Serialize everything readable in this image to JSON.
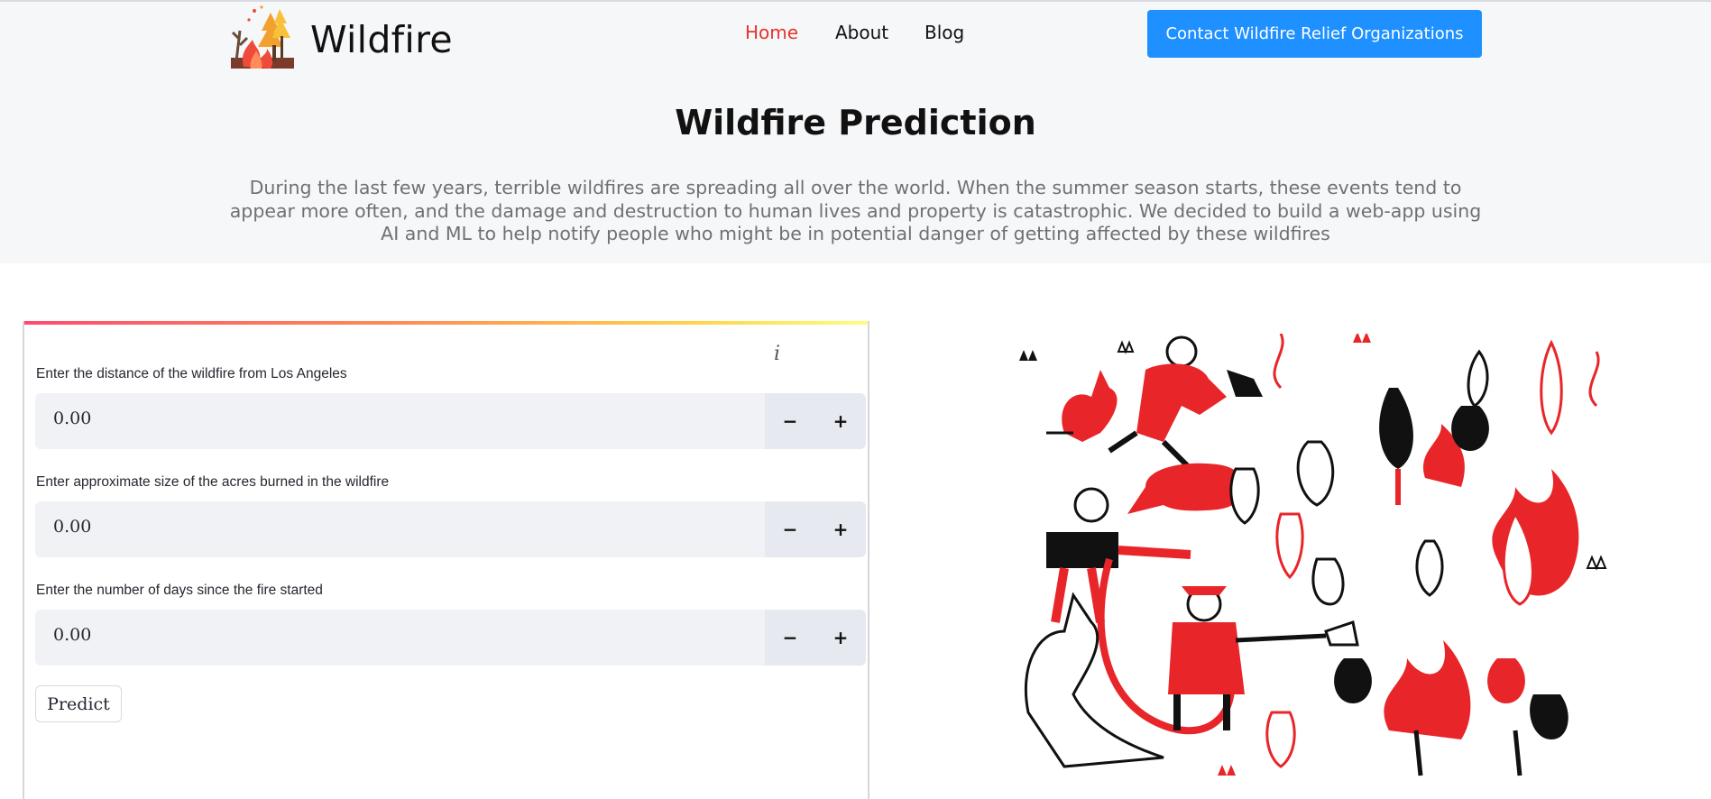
{
  "header": {
    "brand": "Wildfire",
    "nav": [
      {
        "label": "Home",
        "active": true
      },
      {
        "label": "About",
        "active": false
      },
      {
        "label": "Blog",
        "active": false
      }
    ],
    "cta_label": "Contact Wildfire Relief Organizations"
  },
  "hero": {
    "title": "Wildfire Prediction",
    "description": "During the last few years, terrible wildfires are spreading all over the world. When the summer season starts, these events tend to appear more often, and the damage and destruction to human lives and property is catastrophic. We decided to build a web-app using AI and ML to help notify people who might be in potential danger of getting affected by these wildfires"
  },
  "form": {
    "info_glyph": "i",
    "fields": [
      {
        "label": "Enter the distance of the wildfire from Los Angeles",
        "value": "0.00"
      },
      {
        "label": "Enter approximate size of the acres burned in the wildfire",
        "value": "0.00"
      },
      {
        "label": "Enter the number of days since the fire started",
        "value": "0.00"
      }
    ],
    "minus_glyph": "−",
    "plus_glyph": "+",
    "predict_label": "Predict"
  },
  "colors": {
    "accent": "#1e90ff",
    "nav_active": "#e8332f",
    "illustration_red": "#e8262a",
    "illustration_black": "#111111"
  },
  "icons": {
    "logo": "burning-trees-logo-icon",
    "info": "info-icon",
    "illustration": "firefighters-and-animals-illustration"
  }
}
